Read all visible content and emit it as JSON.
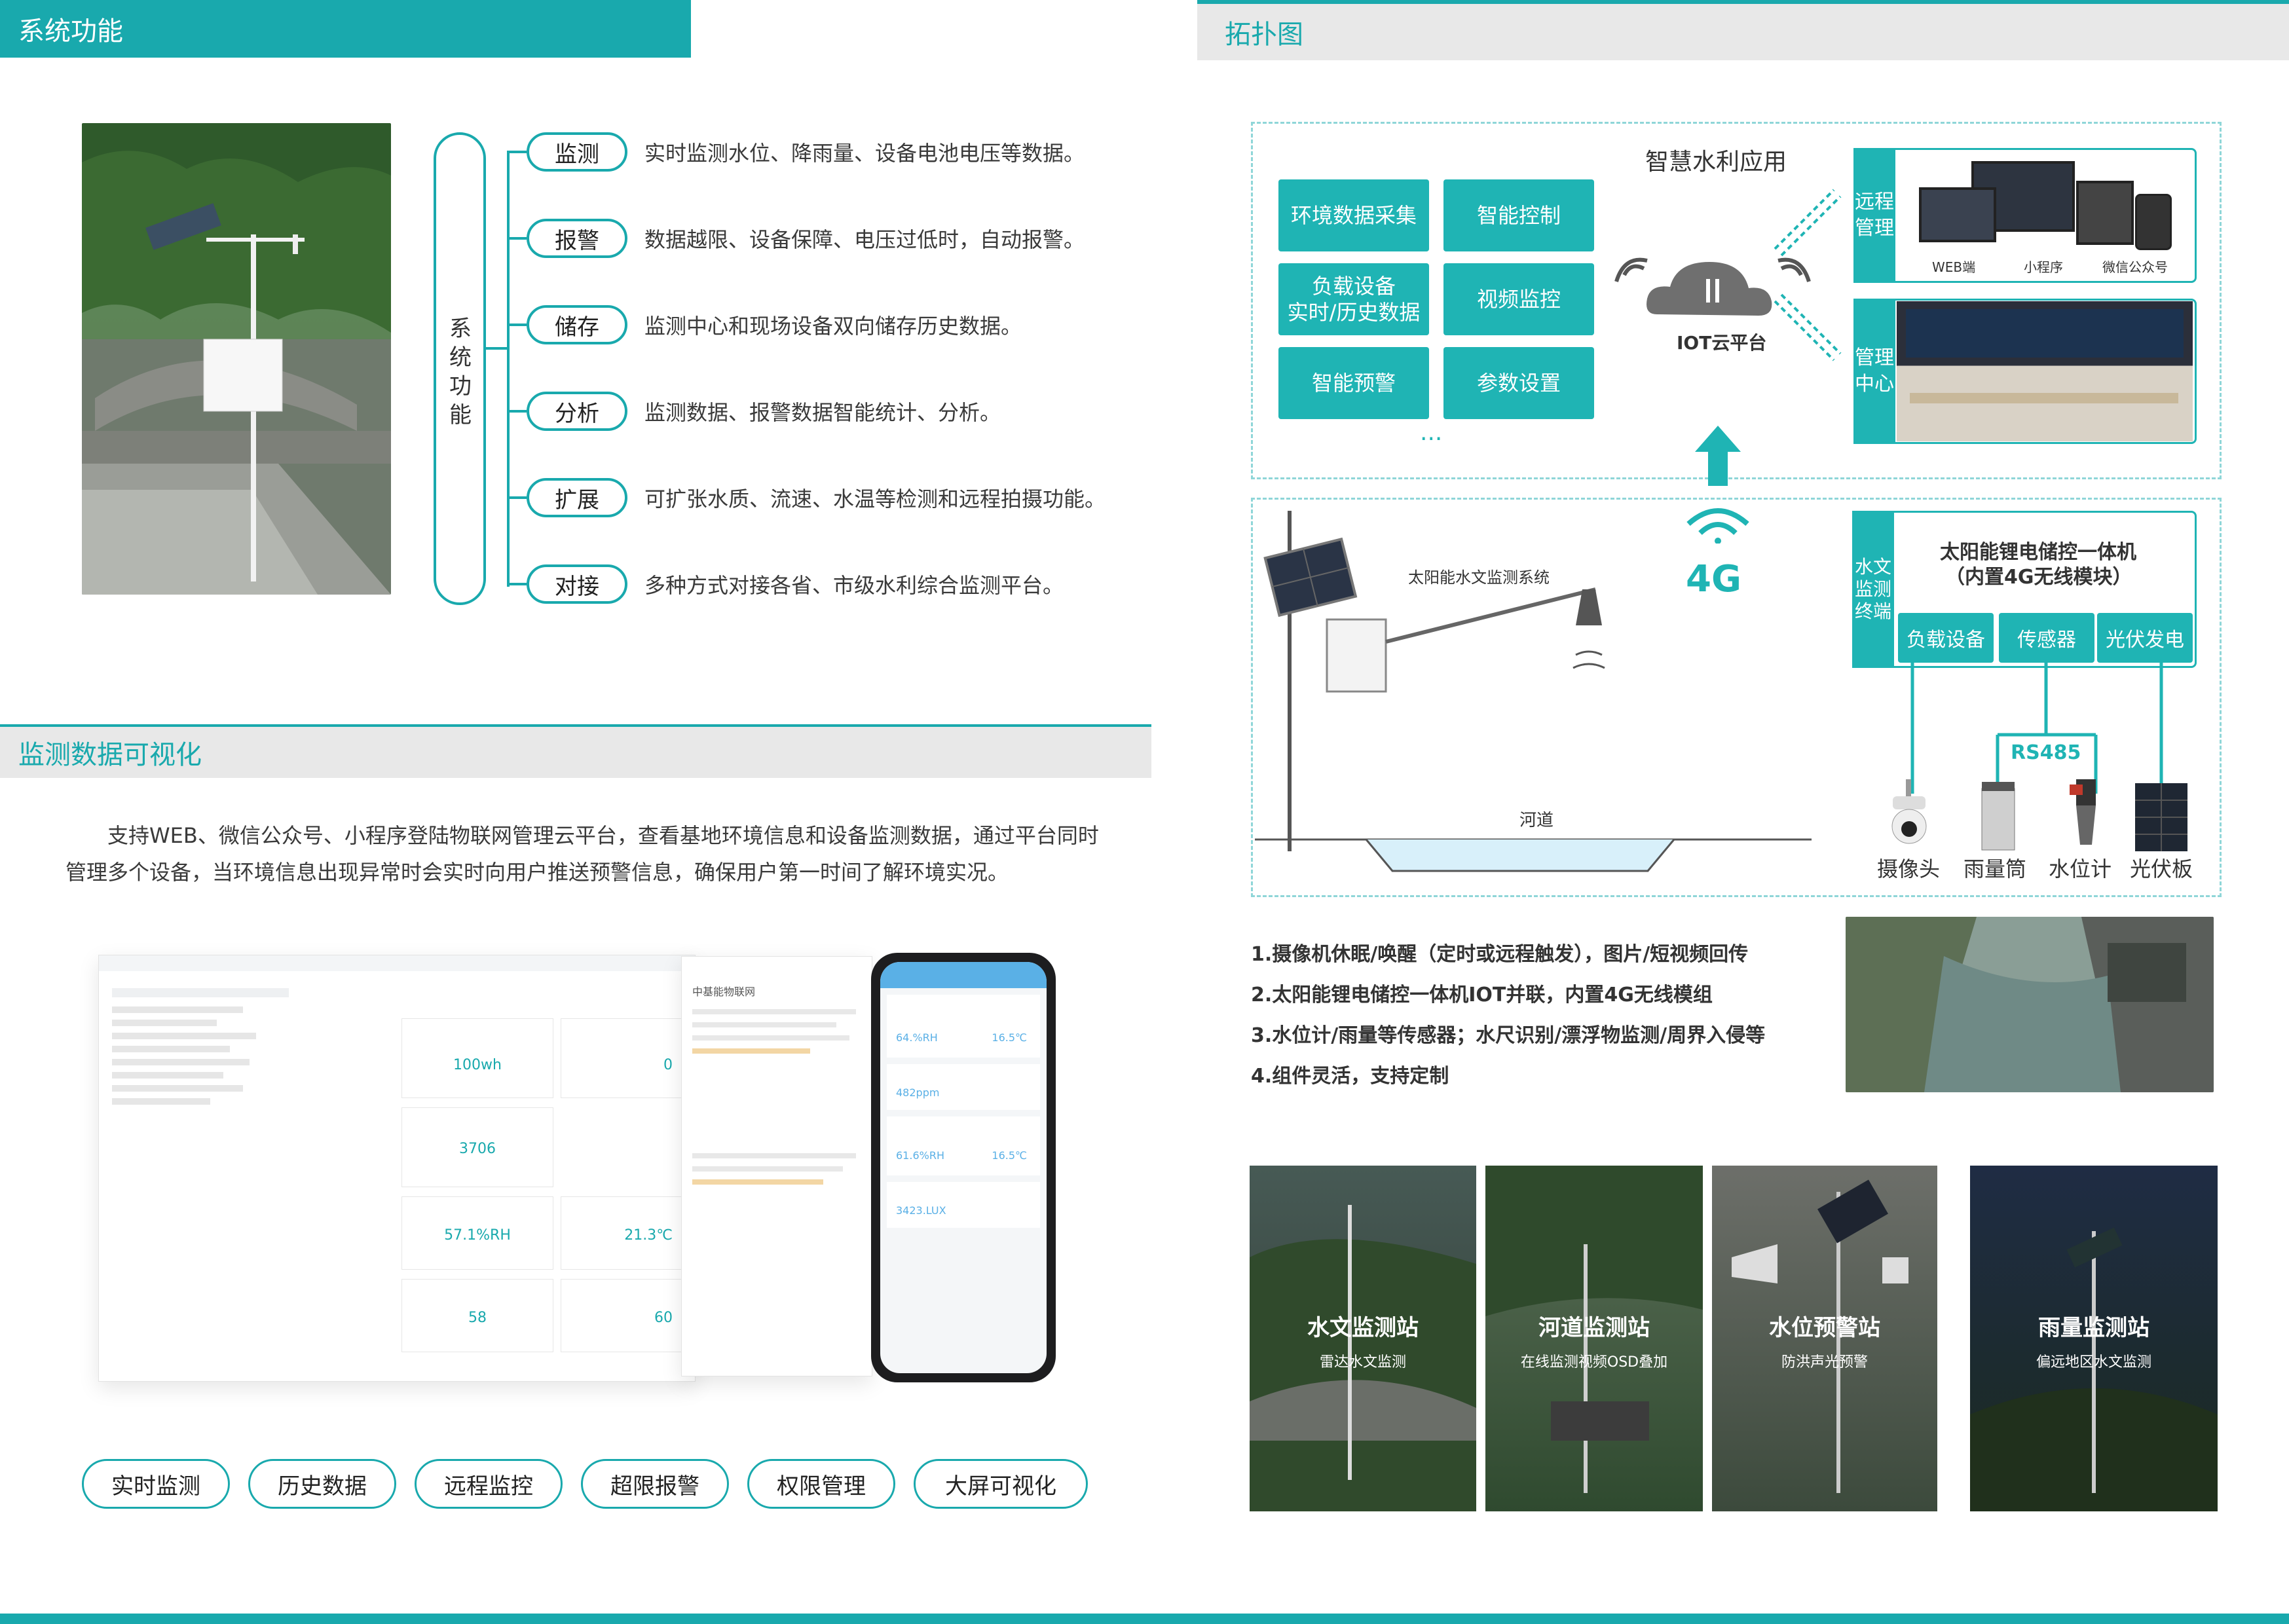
{
  "sections": {
    "features_title": "系统功能",
    "visual_title": "监测数据可视化",
    "topology_title": "拓扑图"
  },
  "features": {
    "vertical_title": "系统功能",
    "items": [
      {
        "label": "监测",
        "desc": "实时监测水位、降雨量、设备电池电压等数据。"
      },
      {
        "label": "报警",
        "desc": "数据越限、设备保障、电压过低时，自动报警。"
      },
      {
        "label": "储存",
        "desc": "监测中心和现场设备双向储存历史数据。"
      },
      {
        "label": "分析",
        "desc": "监测数据、报警数据智能统计、分析。"
      },
      {
        "label": "扩展",
        "desc": "可扩张水质、流速、水温等检测和远程拍摄功能。"
      },
      {
        "label": "对接",
        "desc": "多种方式对接各省、市级水利综合监测平台。"
      }
    ]
  },
  "visual": {
    "desc": "支持WEB、微信公众号、小程序登陆物联网管理云平台，查看基地环境信息和设备监测数据，通过平台同时管理多个设备，当环境信息出现异常时会实时向用户推送预警信息，确保用户第一时间了解环境实况。",
    "chips": [
      "实时监测",
      "历史数据",
      "远程监控",
      "超限报警",
      "权限管理",
      "大屏可视化"
    ],
    "dashboard": {
      "cards": [
        "100wh",
        "0",
        "3706",
        "57.1%RH",
        "21.3℃",
        "58",
        "60"
      ]
    },
    "mobile": {
      "panel_title": "中基能物联网",
      "values": [
        "64.%RH",
        "16.5℃",
        "482ppm",
        "61.6%RH",
        "16.5℃",
        "3423.LUX"
      ]
    }
  },
  "topology": {
    "app_title": "智慧水利应用",
    "app_buttons": [
      "环境数据采集",
      "智能控制",
      "负载设备\n实时/历史数据",
      "视频监控",
      "智能预警",
      "参数设置"
    ],
    "ellipsis": "...",
    "cloud_label": "IOT云平台",
    "remote_label": "远程管理",
    "remote_tags": [
      "WEB端",
      "小程序",
      "微信公众号"
    ],
    "center_label": "管理中心",
    "signal_label": "4G",
    "station_label": "太阳能水文监测系统",
    "river_label": "河道",
    "terminal_label": "水文监测终端",
    "solar_title": "太阳能锂电储控一体机",
    "solar_sub": "（内置4G无线模块）",
    "terminal_buttons": [
      "负载设备",
      "传感器",
      "光伏发电"
    ],
    "rs485": "RS485",
    "devices": [
      "摄像头",
      "雨量筒",
      "水位计",
      "光伏板"
    ],
    "notes": [
      "1.摄像机休眠/唤醒（定时或远程触发），图片/短视频回传",
      "2.太阳能锂电储控一体机IOT并联，内置4G无线模组",
      "3.水位计/雨量等传感器；水尺识别/漂浮物监测/周界入侵等",
      "4.组件灵活，支持定制"
    ],
    "stations": [
      {
        "title": "水文监测站",
        "sub": "雷达水文监测"
      },
      {
        "title": "河道监测站",
        "sub": "在线监测视频OSD叠加"
      },
      {
        "title": "水位预警站",
        "sub": "防洪声光预警"
      },
      {
        "title": "雨量监测站",
        "sub": "偏远地区水文监测"
      }
    ]
  },
  "colors": {
    "accent": "#19a9ad",
    "panel_grey": "#e8e8e8"
  }
}
